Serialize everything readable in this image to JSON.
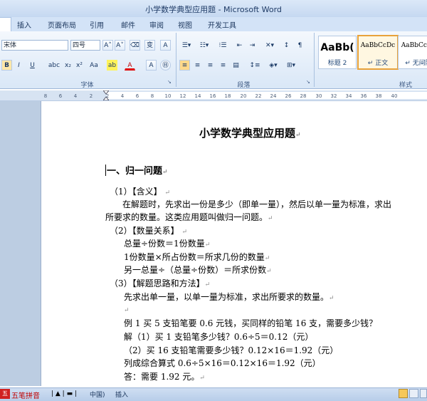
{
  "window": {
    "title": "小学数学典型应用题 - Microsoft Word"
  },
  "tabs": [
    "插入",
    "页面布局",
    "引用",
    "邮件",
    "审阅",
    "视图",
    "开发工具"
  ],
  "ribbon": {
    "font_name": "宋体",
    "font_size": "四号",
    "groups": {
      "font": "字体",
      "paragraph": "段落",
      "styles": "样式"
    },
    "styles": [
      {
        "sample": "AaBb(",
        "name": "标题 2"
      },
      {
        "sample": "AaBbCcDc",
        "name": "↵ 正文"
      },
      {
        "sample": "AaBbCcDc",
        "name": "↵ 无间隔"
      }
    ]
  },
  "ruler": [
    "8",
    "6",
    "4",
    "2",
    "2",
    "4",
    "6",
    "8",
    "10",
    "12",
    "14",
    "16",
    "18",
    "20",
    "22",
    "24",
    "26",
    "28",
    "30",
    "32",
    "34",
    "36",
    "38",
    "40"
  ],
  "document": {
    "title": "小学数学典型应用题",
    "heading": "一、归一问题",
    "lines": [
      "（1）【含义】",
      "在解题时，先求出一份是多少（即单一量），然后以单一量为标准，求出",
      "所要求的数量。这类应用题叫做归一问题。",
      "（2）【数量关系】",
      "总量÷份数＝1份数量",
      "1份数量×所占份数＝所求几份的数量",
      "另一总量÷（总量÷份数）＝所求份数",
      "（3）【解题思路和方法】",
      "先求出单一量，以单一量为标准，求出所要求的数量。",
      "",
      "例 1 买 5 支铅笔要 0.6 元钱，买同样的铅笔 16 支，需要多少钱？",
      "解（1）买 1 支铅笔多少钱？0.6÷5＝0.12（元）",
      "（2）买 16 支铅笔需要多少钱？0.12×16＝1.92（元）",
      "列成综合算式 0.6÷5×16＝0.12×16＝1.92（元）",
      "答：需要 1.92 元。"
    ]
  },
  "status": {
    "ime": "五笔拼音",
    "lang": "中国)",
    "mode": "插入"
  }
}
